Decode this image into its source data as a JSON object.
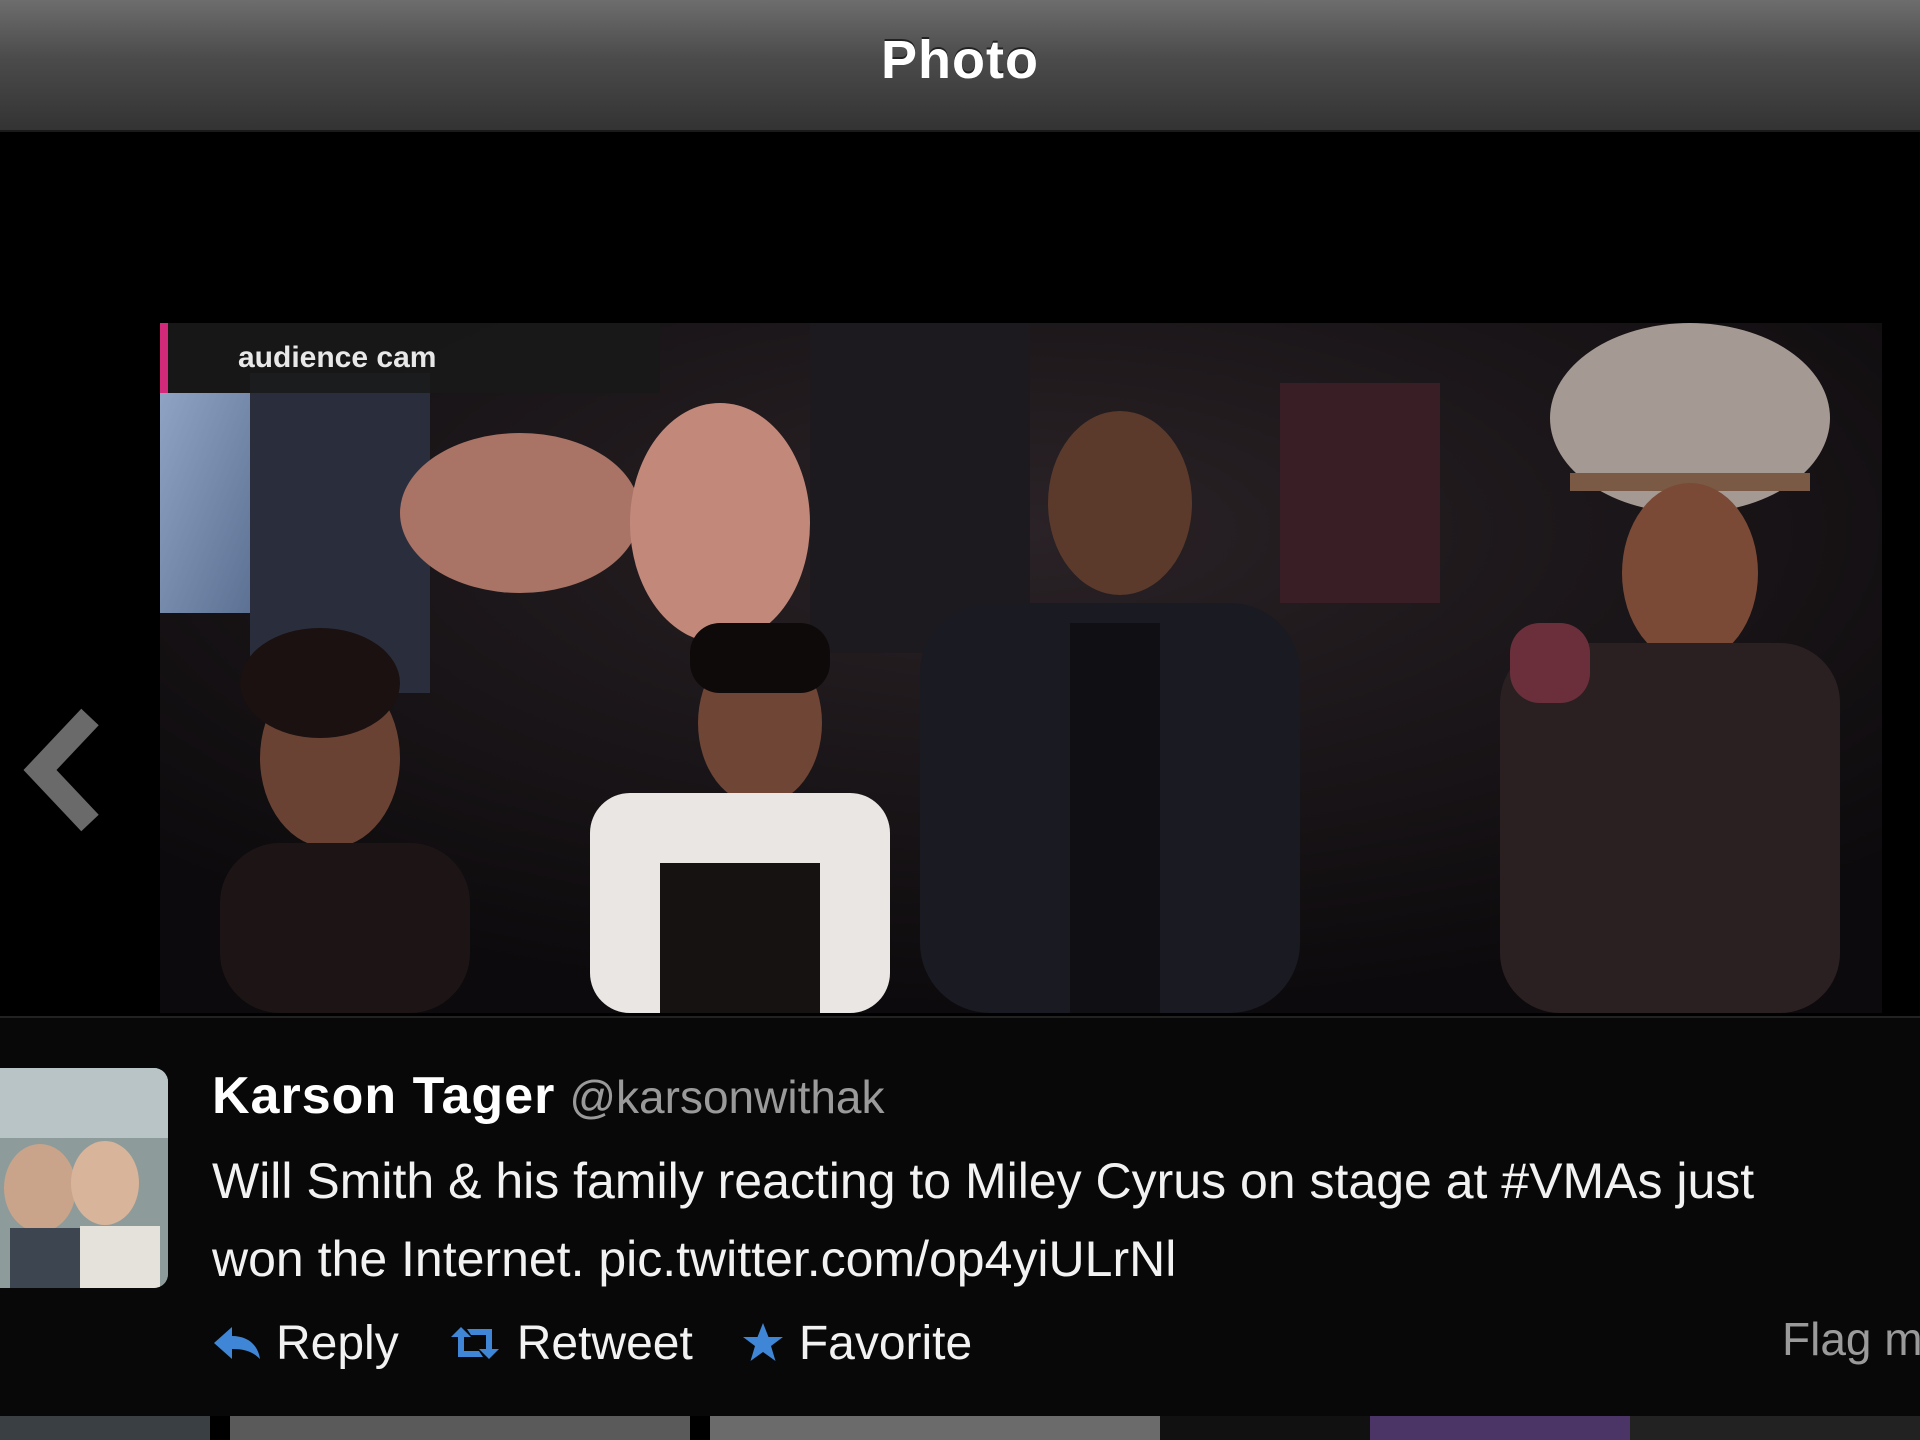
{
  "header": {
    "title": "Photo"
  },
  "photo": {
    "overlay_label": "audience cam"
  },
  "tweet": {
    "author_name": "Karson Tager",
    "author_handle": "@karsonwithak",
    "text_line1": "Will Smith & his family reacting to Miley Cyrus on stage at #VMAs just",
    "text_line2": "won the Internet. pic.twitter.com/op4yiULrNl"
  },
  "actions": {
    "reply_label": "Reply",
    "retweet_label": "Retweet",
    "favorite_label": "Favorite",
    "flag_label": "Flag m"
  },
  "colors": {
    "action_icon_blue": "#3f86d6",
    "label_accent_pink": "#d2297b"
  }
}
